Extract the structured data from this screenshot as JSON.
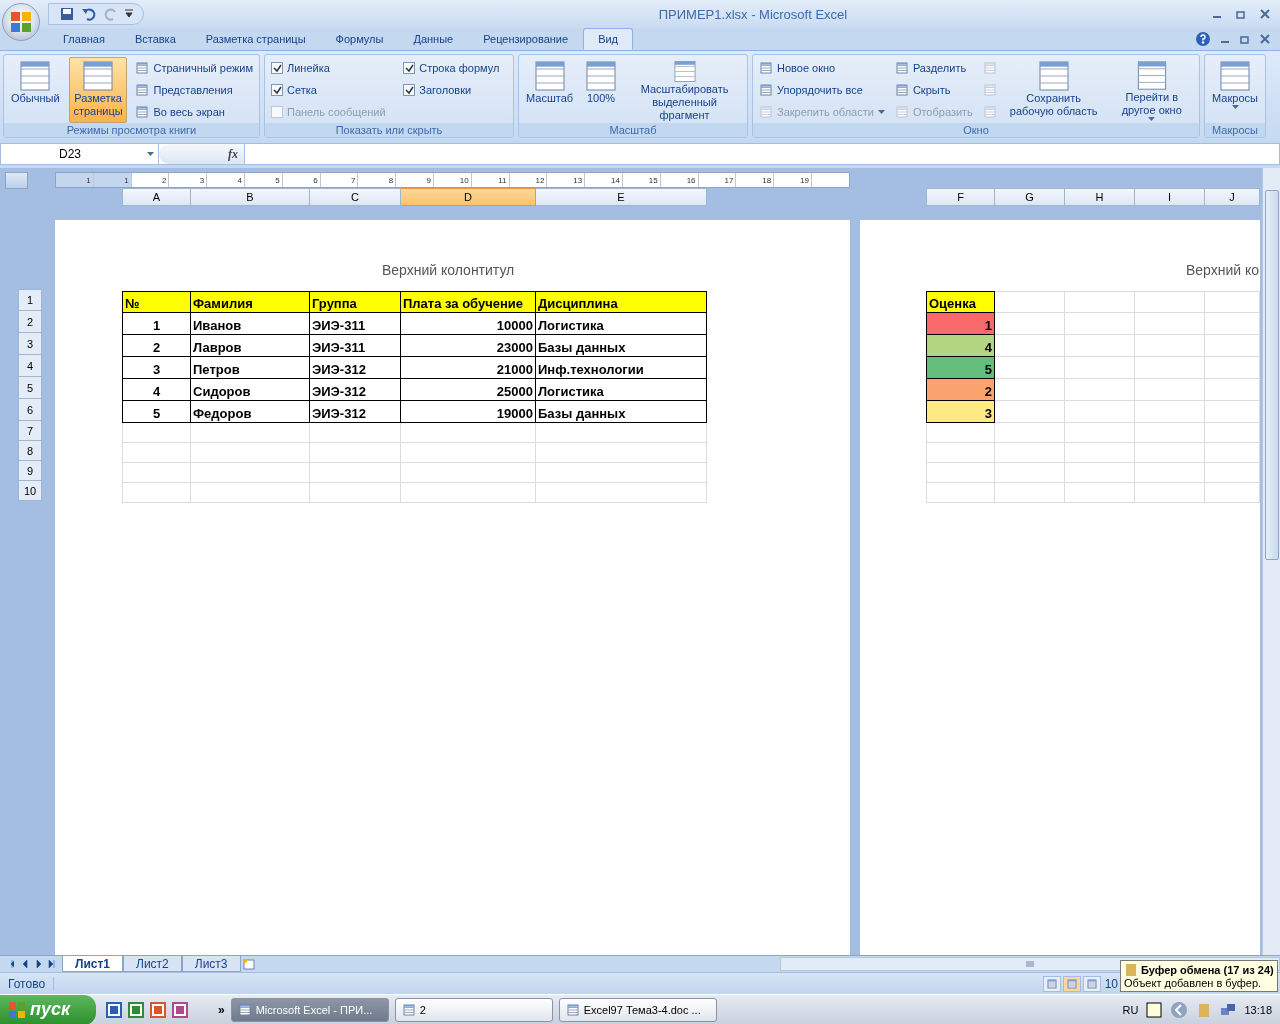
{
  "window": {
    "title": "ПРИМЕР1.xlsx - Microsoft Excel"
  },
  "ribbon_tabs": [
    {
      "label": "Главная",
      "selected": false
    },
    {
      "label": "Вставка",
      "selected": false
    },
    {
      "label": "Разметка страницы",
      "selected": false
    },
    {
      "label": "Формулы",
      "selected": false
    },
    {
      "label": "Данные",
      "selected": false
    },
    {
      "label": "Рецензирование",
      "selected": false
    },
    {
      "label": "Вид",
      "selected": true
    }
  ],
  "ribbon_groups": [
    {
      "title": "Режимы просмотра книги",
      "items": [
        {
          "kind": "large",
          "label": "Обычный",
          "selected": false
        },
        {
          "kind": "large",
          "label": "Разметка страницы",
          "selected": true
        },
        {
          "kind": "small",
          "label": "Страничный режим"
        },
        {
          "kind": "small",
          "label": "Представления"
        },
        {
          "kind": "small",
          "label": "Во весь экран"
        }
      ]
    },
    {
      "title": "Показать или скрыть",
      "items": [
        {
          "kind": "check",
          "label": "Линейка",
          "checked": true,
          "disabled": false
        },
        {
          "kind": "check",
          "label": "Сетка",
          "checked": true,
          "disabled": false
        },
        {
          "kind": "check",
          "label": "Панель сообщений",
          "checked": false,
          "disabled": true
        },
        {
          "kind": "check",
          "label": "Строка формул",
          "checked": true,
          "disabled": false
        },
        {
          "kind": "check",
          "label": "Заголовки",
          "checked": true,
          "disabled": false
        }
      ]
    },
    {
      "title": "Масштаб",
      "items": [
        {
          "kind": "large",
          "label": "Масштаб",
          "selected": false
        },
        {
          "kind": "large",
          "label": "100%",
          "selected": false
        },
        {
          "kind": "large",
          "label": "Масштабировать выделенный фрагмент",
          "selected": false
        }
      ]
    },
    {
      "title": "Окно",
      "items": [
        {
          "kind": "small",
          "label": "Новое окно"
        },
        {
          "kind": "small",
          "label": "Упорядочить все"
        },
        {
          "kind": "small",
          "label": "Закрепить области",
          "disabled": true,
          "dropdown": true
        },
        {
          "kind": "small",
          "label": "Разделить"
        },
        {
          "kind": "small",
          "label": "Скрыть"
        },
        {
          "kind": "small",
          "label": "Отобразить",
          "disabled": true
        },
        {
          "kind": "icon",
          "disabled": true
        },
        {
          "kind": "icon",
          "disabled": true
        },
        {
          "kind": "icon",
          "disabled": true
        },
        {
          "kind": "large",
          "label": "Сохранить рабочую область",
          "selected": false
        },
        {
          "kind": "large",
          "label": "Перейти в другое окно",
          "selected": false,
          "dropdown": true
        }
      ]
    },
    {
      "title": "Макросы",
      "items": [
        {
          "kind": "large",
          "label": "Макросы",
          "selected": false,
          "dropdown": true
        }
      ]
    }
  ],
  "formula_bar": {
    "name_box": "D23",
    "function_label": "fx"
  },
  "ruler": {
    "labels": [
      "1",
      "1",
      "2",
      "3",
      "4",
      "5",
      "6",
      "7",
      "8",
      "9",
      "10",
      "11",
      "12",
      "13",
      "14",
      "15",
      "16",
      "17",
      "18",
      "19"
    ]
  },
  "page_1": {
    "header_text": "Верхний колонтитул",
    "columns": [
      {
        "label": "A",
        "selected": false
      },
      {
        "label": "B",
        "selected": false
      },
      {
        "label": "C",
        "selected": false
      },
      {
        "label": "D",
        "selected": true
      },
      {
        "label": "E",
        "selected": false
      }
    ],
    "table_header": [
      "№",
      "Фамилия",
      "Группа",
      "Плата за обучение",
      "Дисциплина"
    ],
    "rows": [
      [
        "1",
        "Иванов",
        "ЭИЭ-311",
        "10000",
        "Логистика"
      ],
      [
        "2",
        "Лавров",
        "ЭИЭ-311",
        "23000",
        "Базы данных"
      ],
      [
        "3",
        "Петров",
        "ЭИЭ-312",
        "21000",
        "Инф.технологии"
      ],
      [
        "4",
        "Сидоров",
        "ЭИЭ-312",
        "25000",
        "Логистика"
      ],
      [
        "5",
        "Федоров",
        "ЭИЭ-312",
        "19000",
        "Базы данных"
      ]
    ]
  },
  "row_headers": [
    "1",
    "2",
    "3",
    "4",
    "5",
    "6",
    "7",
    "8",
    "9",
    "10"
  ],
  "page_2": {
    "header_text": "Верхний ко",
    "columns": [
      {
        "label": "F",
        "selected": false
      },
      {
        "label": "G",
        "selected": false
      },
      {
        "label": "H",
        "selected": false
      },
      {
        "label": "I",
        "selected": false
      },
      {
        "label": "J",
        "selected": false
      }
    ],
    "grade_header": "Оценка",
    "grades": [
      {
        "value": "1",
        "color": "#f8696b"
      },
      {
        "value": "4",
        "color": "#b1d580"
      },
      {
        "value": "5",
        "color": "#63be7b"
      },
      {
        "value": "2",
        "color": "#fba36f"
      },
      {
        "value": "3",
        "color": "#ffe985"
      }
    ]
  },
  "sheet_tabs": [
    {
      "label": "Лист1",
      "selected": true
    },
    {
      "label": "Лист2",
      "selected": false
    },
    {
      "label": "Лист3",
      "selected": false
    }
  ],
  "status_bar": {
    "text": "Готово",
    "views": [
      {
        "selected": false
      },
      {
        "selected": true
      },
      {
        "selected": false
      }
    ],
    "zoom": "10"
  },
  "tooltip": {
    "title": "Буфер обмена (17 из 24)",
    "text": "Объект добавлен в буфер."
  },
  "taskbar": {
    "start": "пуск",
    "more": "»",
    "tasks": [
      {
        "label": "Microsoft Excel - ПРИ...",
        "selected": true
      },
      {
        "label": "2",
        "selected": false
      },
      {
        "label": "Excel97 Тема3-4.doc ...",
        "selected": false
      }
    ],
    "language": "RU",
    "clock": "13:18"
  }
}
